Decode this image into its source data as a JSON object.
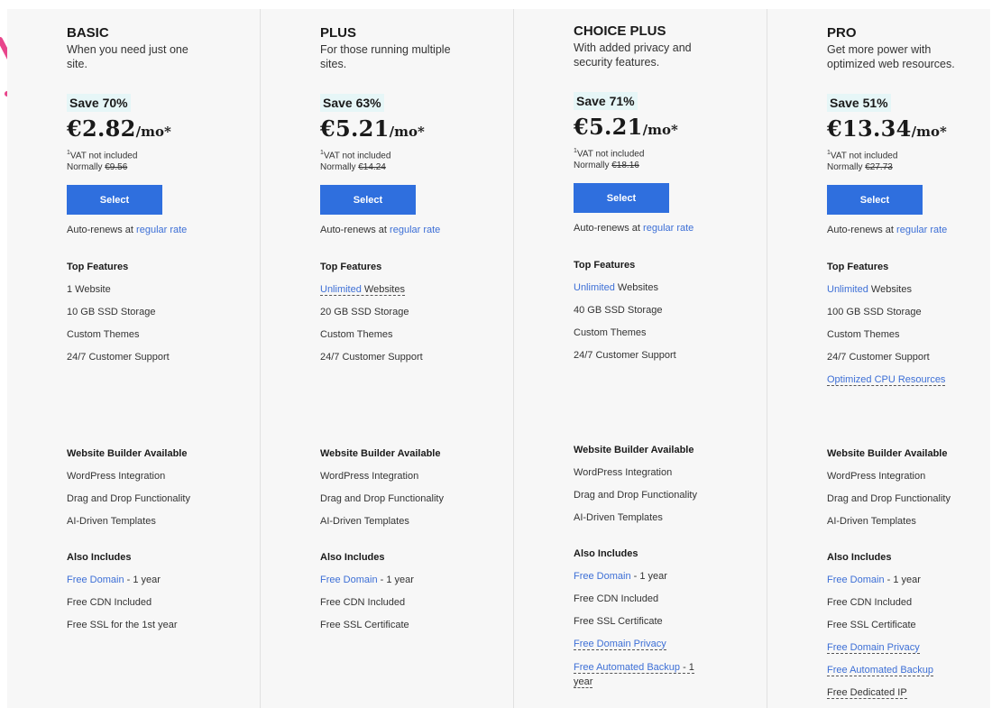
{
  "accent_color": "#2f6fde",
  "link_color": "#3d6fd6",
  "badge_color": "#e6f6f7",
  "arrow_color": "#e8458b",
  "plans": [
    {
      "name": "BASIC",
      "desc": "When you need just one site.",
      "save": "Save 70%",
      "price": "€2.82",
      "per": "/mo*",
      "vat_mark": "1",
      "vat": "VAT not included",
      "normally_label": "Normally",
      "normally_price": "€9.56",
      "select": "Select",
      "autorenew_text": "Auto-renews at",
      "autorenew_link": "regular rate",
      "top_title": "Top Features",
      "top": [
        {
          "text": "1 Website"
        },
        {
          "text": "10 GB SSD Storage"
        },
        {
          "text": "Custom Themes"
        },
        {
          "text": "24/7 Customer Support"
        }
      ],
      "builder_title": "Website Builder Available",
      "builder": [
        "WordPress Integration",
        "Drag and Drop Functionality",
        "AI-Driven Templates"
      ],
      "also_title": "Also Includes",
      "also": [
        {
          "link": "Free Domain",
          "rest": " - 1 year"
        },
        {
          "text": "Free CDN Included"
        },
        {
          "text": "Free SSL for the 1st year"
        }
      ]
    },
    {
      "name": "PLUS",
      "desc": "For those running multiple sites.",
      "save": "Save 63%",
      "price": "€5.21",
      "per": "/mo*",
      "vat_mark": "1",
      "vat": "VAT not included",
      "normally_label": "Normally",
      "normally_price": "€14.24",
      "select": "Select",
      "autorenew_text": "Auto-renews at",
      "autorenew_link": "regular rate",
      "top_title": "Top Features",
      "top": [
        {
          "link": "Unlimited",
          "rest": " Websites",
          "dashed": true
        },
        {
          "text": "20 GB SSD Storage"
        },
        {
          "text": "Custom Themes"
        },
        {
          "text": "24/7 Customer Support"
        }
      ],
      "builder_title": "Website Builder Available",
      "builder": [
        "WordPress Integration",
        "Drag and Drop Functionality",
        "AI-Driven Templates"
      ],
      "also_title": "Also Includes",
      "also": [
        {
          "link": "Free Domain",
          "rest": " - 1 year"
        },
        {
          "text": "Free CDN Included"
        },
        {
          "text": "Free SSL Certificate"
        }
      ]
    },
    {
      "name": "CHOICE PLUS",
      "desc": "With added privacy and security features.",
      "save": "Save 71%",
      "price": "€5.21",
      "per": "/mo*",
      "vat_mark": "1",
      "vat": "VAT not included",
      "normally_label": "Normally",
      "normally_price": "€18.16",
      "select": "Select",
      "autorenew_text": "Auto-renews at",
      "autorenew_link": "regular rate",
      "top_title": "Top Features",
      "top": [
        {
          "link": "Unlimited",
          "rest": " Websites"
        },
        {
          "text": "40 GB SSD Storage"
        },
        {
          "text": "Custom Themes"
        },
        {
          "text": "24/7 Customer Support"
        }
      ],
      "builder_title": "Website Builder Available",
      "builder": [
        "WordPress Integration",
        "Drag and Drop Functionality",
        "AI-Driven Templates"
      ],
      "also_title": "Also Includes",
      "also": [
        {
          "link": "Free Domain",
          "rest": " - 1 year"
        },
        {
          "text": "Free CDN Included"
        },
        {
          "text": "Free SSL Certificate"
        },
        {
          "link": "Free Domain Privacy",
          "dashed": true
        },
        {
          "link": "Free Automated Backup",
          "rest": " - 1 year",
          "dashed": true,
          "wrap": true
        }
      ]
    },
    {
      "name": "PRO",
      "desc": "Get more power with optimized web resources.",
      "save": "Save 51%",
      "price": "€13.34",
      "per": "/mo*",
      "vat_mark": "1",
      "vat": "VAT not included",
      "normally_label": "Normally",
      "normally_price": "€27.73",
      "select": "Select",
      "autorenew_text": "Auto-renews at",
      "autorenew_link": "regular rate",
      "top_title": "Top Features",
      "top": [
        {
          "link": "Unlimited",
          "rest": " Websites"
        },
        {
          "text": "100 GB SSD Storage"
        },
        {
          "text": "Custom Themes"
        },
        {
          "text": "24/7 Customer Support"
        },
        {
          "link": "Optimized CPU Resources",
          "dashed": true
        }
      ],
      "builder_title": "Website Builder Available",
      "builder": [
        "WordPress Integration",
        "Drag and Drop Functionality",
        "AI-Driven Templates"
      ],
      "also_title": "Also Includes",
      "also": [
        {
          "link": "Free Domain",
          "rest": " - 1 year"
        },
        {
          "text": "Free CDN Included"
        },
        {
          "text": "Free SSL Certificate"
        },
        {
          "link": "Free Domain Privacy",
          "dashed": true
        },
        {
          "link": "Free Automated Backup",
          "dashed": true
        },
        {
          "text": "Free Dedicated IP",
          "dashed": true
        }
      ]
    }
  ]
}
